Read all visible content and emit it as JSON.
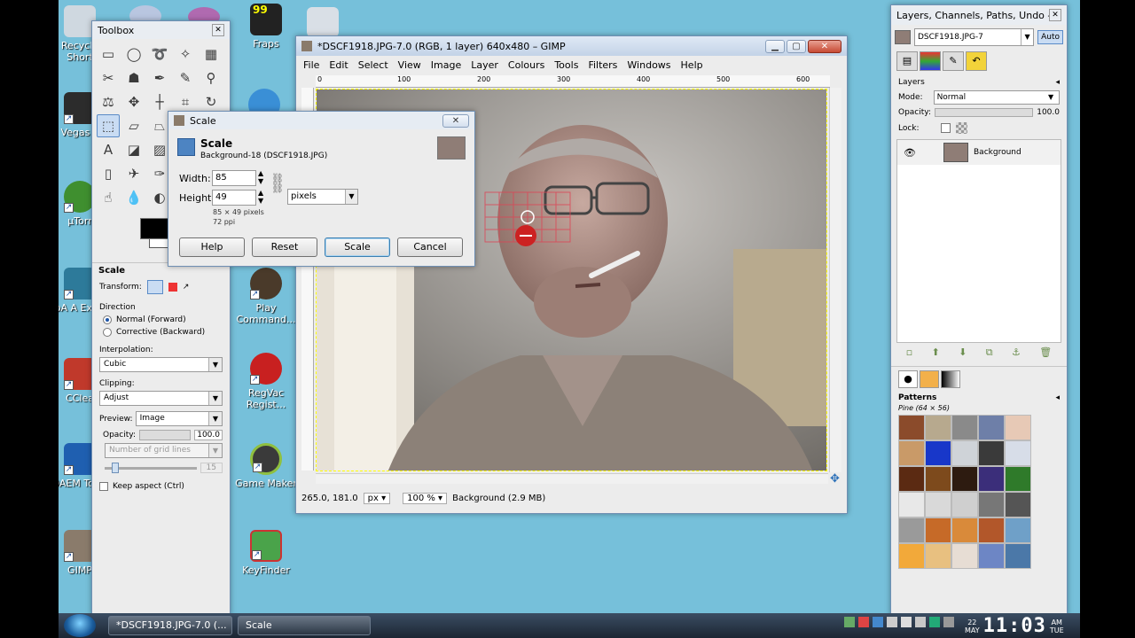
{
  "desktop": {
    "icons": [
      {
        "label": "Recycle Short",
        "color": "#cfd8e0"
      },
      {
        "label": "Vegas P",
        "color": "#2c2c2c"
      },
      {
        "label": "µTorr",
        "color": "#3f8f2f"
      },
      {
        "label": "AoA A Extrac",
        "color": "#2d7a9a"
      },
      {
        "label": "CClea",
        "color": "#c0392b"
      },
      {
        "label": "DAEM Tools",
        "color": "#1f5fb0"
      },
      {
        "label": "GIMP",
        "color": "#8a7b6b"
      },
      {
        "label": "Fraps",
        "color": "#222222"
      },
      {
        "label": "Play Command...",
        "color": "#4a3a2a"
      },
      {
        "label": "RegVac Regist...",
        "color": "#c82020"
      },
      {
        "label": "Game Maker",
        "color": "#3a3a3a"
      },
      {
        "label": "KeyFinder",
        "color": "#4aa34a"
      }
    ]
  },
  "toolbox": {
    "title": "Toolbox",
    "section_title": "Scale",
    "transform_label": "Transform:",
    "direction_label": "Direction",
    "direction_normal": "Normal (Forward)",
    "direction_corrective": "Corrective (Backward)",
    "interpolation_label": "Interpolation:",
    "interpolation_value": "Cubic",
    "clipping_label": "Clipping:",
    "clipping_value": "Adjust",
    "preview_label": "Preview:",
    "preview_value": "Image",
    "opacity_label": "Opacity:",
    "opacity_value": "100.0",
    "grid_lines_value": "Number of grid lines",
    "grid_count": "15",
    "keep_aspect": "Keep aspect (Ctrl)"
  },
  "image_window": {
    "title": "*DSCF1918.JPG-7.0 (RGB, 1 layer) 640x480 – GIMP",
    "menu": [
      "File",
      "Edit",
      "Select",
      "View",
      "Image",
      "Layer",
      "Colours",
      "Tools",
      "Filters",
      "Windows",
      "Help"
    ],
    "ruler_ticks": [
      "0",
      "100",
      "200",
      "300",
      "400",
      "500",
      "600"
    ],
    "status_coords": "265.0, 181.0",
    "status_unit": "px",
    "status_zoom": "100 %",
    "status_info": "Background (2.9 MB)"
  },
  "scale_dialog": {
    "title": "Scale",
    "heading": "Scale",
    "subheading": "Background-18 (DSCF1918.JPG)",
    "width_label": "Width:",
    "width_value": "85",
    "height_label": "Height:",
    "height_value": "49",
    "unit": "pixels",
    "size_info": "85 × 49 pixels",
    "resolution": "72 ppi",
    "help": "Help",
    "reset": "Reset",
    "scale": "Scale",
    "cancel": "Cancel"
  },
  "dock": {
    "title": "Layers, Channels, Paths, Undo - Br...",
    "image_select": "DSCF1918.JPG-7",
    "auto": "Auto",
    "layers_title": "Layers",
    "mode_label": "Mode:",
    "mode_value": "Normal",
    "opacity_label": "Opacity:",
    "opacity_value": "100.0",
    "lock_label": "Lock:",
    "layer_name": "Background",
    "patterns_title": "Patterns",
    "pattern_name": "Pine (64 × 56)"
  },
  "taskbar": {
    "item1": "*DSCF1918.JPG-7.0 (...",
    "item2": "Scale",
    "date_day": "22",
    "date_month": "MAY",
    "time": "11:03",
    "ampm": "AM",
    "weekday": "TUE"
  },
  "colors": {
    "desktop": "#76c0da",
    "accent": "#3c7fb1"
  }
}
